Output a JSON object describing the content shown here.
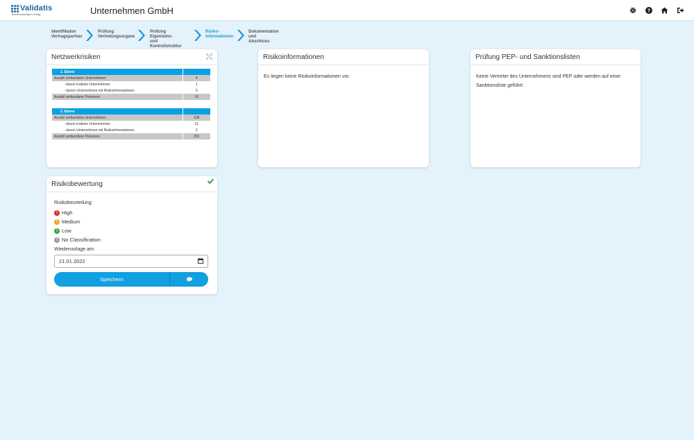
{
  "header": {
    "logo_name": "Validatis",
    "logo_sub": "Bundesanzeiger Verlag",
    "title": "Unternehmen GmbH",
    "icons": [
      "gear-icon",
      "help-icon",
      "home-icon",
      "logout-icon"
    ]
  },
  "stepper": {
    "steps": [
      {
        "line1": "Identifikaton",
        "line2": "Vertragspartner"
      },
      {
        "line1": "Prüfung",
        "line2": "Vertretungsorgane"
      },
      {
        "line1": "Prüfung Eigentums-",
        "line2": "und Kontrollstruktur"
      },
      {
        "line1": "Risiko-",
        "line2": "informationen",
        "active": true
      },
      {
        "line1": "Dokumentation und",
        "line2": "Abschluss"
      }
    ]
  },
  "network": {
    "title": "Netzwerkrisiken",
    "levels": [
      {
        "header": "1. Ebene",
        "rows": [
          {
            "label": "Anzahl verbundene Unternehmen",
            "value": "4",
            "style": "gray"
          },
          {
            "label": "- davon inaktive Unternehmen",
            "value": "1",
            "style": "indent"
          },
          {
            "label": "- davon Unternehmen mit Risikoinformationen",
            "value": "0",
            "style": "indent"
          },
          {
            "label": "Anzahl verbundene Personen",
            "value": "16",
            "style": "gray"
          }
        ]
      },
      {
        "header": "2. Ebene",
        "rows": [
          {
            "label": "Anzahl verbundene Unternehmen",
            "value": "106",
            "style": "gray"
          },
          {
            "label": "- davon inaktive Unternehmen",
            "value": "21",
            "style": "indent"
          },
          {
            "label": "- davon Unternehmen mit Risikoinformationen",
            "value": "2",
            "style": "indent"
          },
          {
            "label": "Anzahl verbundene Personen",
            "value": "251",
            "style": "gray"
          }
        ]
      }
    ]
  },
  "risk_info": {
    "title": "Risikoinformationen",
    "text": "Es liegen keine Risikoinformationen vor."
  },
  "pep": {
    "title": "Prüfung PEP- und Sanktionslisten",
    "text": "Keine Vertreter des Unternehmens sind PEP oder werden auf einer Sanktionsliste geführt."
  },
  "assessment": {
    "title": "Risikobewertung",
    "rating_label": "Risikobeurteilung:",
    "options": [
      {
        "label": "High",
        "color": "#e0262b",
        "glyph": "!"
      },
      {
        "label": "Medium",
        "color": "#f0a22a",
        "glyph": "!"
      },
      {
        "label": "Low",
        "color": "#3aa63a",
        "glyph": "!"
      },
      {
        "label": "No Classification",
        "color": "#9a9a9a",
        "glyph": "!"
      }
    ],
    "resubmission_label": "Wiedervorlage am:",
    "date_value": "21.01.2022",
    "save_label": "Speichern"
  },
  "colors": {
    "accent": "#12a0e0",
    "background": "#e4f2fb",
    "check": "#3aa63a"
  }
}
